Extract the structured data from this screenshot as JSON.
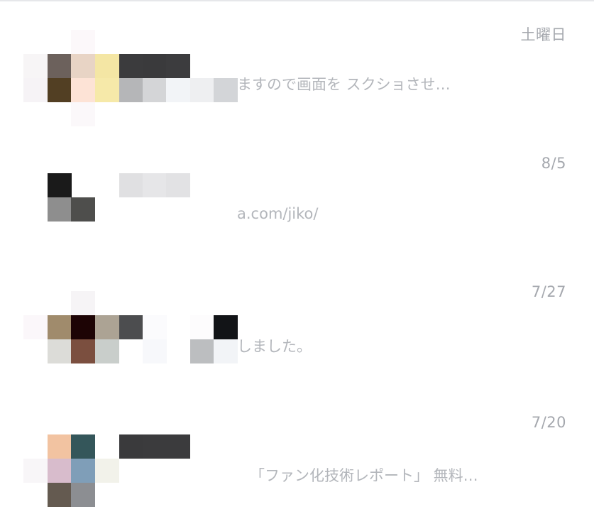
{
  "chats": [
    {
      "date": "土曜日",
      "preview": "ますので画面を スクショさせ…",
      "mosaic_colors": [
        "#f7f5f6",
        "#fcf8fa",
        "#f6f3f6",
        "#6c615c",
        "#e8d4c5",
        "#f4e6a4",
        "#3b3b3d",
        "#3a3a3c",
        "#3c3c3e",
        "#523f23",
        "#fde3d6",
        "#f6e9a9",
        "#b5b6b8",
        "#d4d5d7",
        "#f2f4f7",
        "#eeeff1",
        "#d3d5d8",
        "#fbf8fa"
      ]
    },
    {
      "date": "8/5",
      "preview": "a.com/jiko/",
      "mosaic_colors": [
        "#1a1a1a",
        "#e0e0e2",
        "#e6e6e8",
        "#e2e2e4",
        "#8e8e8e",
        "#4e4e4c"
      ]
    },
    {
      "date": "7/27",
      "preview": "しました。",
      "mosaic_colors": [
        "#fbf7fa",
        "#f6f4f6",
        "#a08b6c",
        "#1d0405",
        "#aca394",
        "#4c4d4f",
        "#fbfbfd",
        "#fdfcfd",
        "#121417",
        "#dcdcd8",
        "#7b4f3f",
        "#c9cecb",
        "#f7f8fb",
        "#bcbec0",
        "#f2f4f7"
      ]
    },
    {
      "date": "7/20",
      "preview": "「ファン化技術レポート」 無料…",
      "mosaic_colors": [
        "#f2c3a1",
        "#34565a",
        "#3a3a3c",
        "#3b3b3d",
        "#3b3b3d",
        "#d8bccc",
        "#7f9eb8",
        "#f2f2ea",
        "#645a50",
        "#8c8e92",
        "#f8f6f8"
      ]
    }
  ]
}
